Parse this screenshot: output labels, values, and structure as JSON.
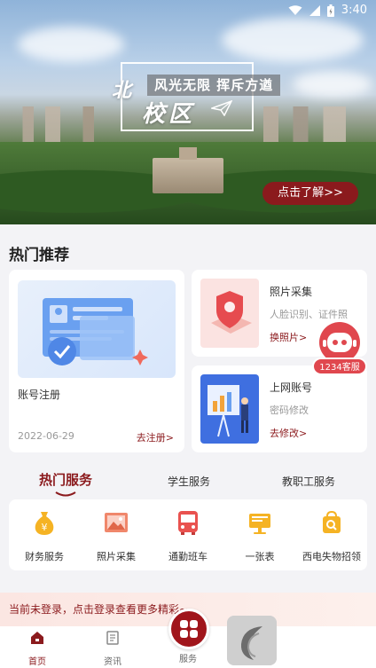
{
  "status_bar": {
    "time": "3:40"
  },
  "banner": {
    "logo_top": "北",
    "logo_bottom": "校区",
    "slogan": "风光无限 挥斥方遒",
    "more_button": "点击了解>>"
  },
  "hot_recommend": {
    "title": "热门推荐",
    "big_card": {
      "title": "账号注册",
      "date": "2022-06-29",
      "link": "去注册>"
    },
    "small_cards": [
      {
        "title": "照片采集",
        "desc": "人脸识别、证件照",
        "link": "换照片>"
      },
      {
        "title": "上网账号",
        "desc": "密码修改",
        "link": "去修改>"
      }
    ]
  },
  "kefu": {
    "label": "1234客服"
  },
  "service_tabs": [
    "热门服务",
    "学生服务",
    "教职工服务"
  ],
  "services": [
    {
      "label": "财务服务",
      "icon": "money-bag-icon"
    },
    {
      "label": "照片采集",
      "icon": "photo-icon"
    },
    {
      "label": "通勤班车",
      "icon": "bus-icon"
    },
    {
      "label": "一张表",
      "icon": "form-icon"
    },
    {
      "label": "西电失物招领",
      "icon": "lost-found-icon"
    }
  ],
  "login_prompt": "当前未登录，点击登录查看更多精彩~",
  "bottom_nav": [
    {
      "label": "首页",
      "icon": "home-icon"
    },
    {
      "label": "资讯",
      "icon": "news-icon"
    },
    {
      "label": "服务",
      "icon": "service-grid-icon"
    }
  ],
  "colors": {
    "brand": "#8b1a1d",
    "accent": "#e0474e",
    "icon_gold": "#f5b324"
  }
}
